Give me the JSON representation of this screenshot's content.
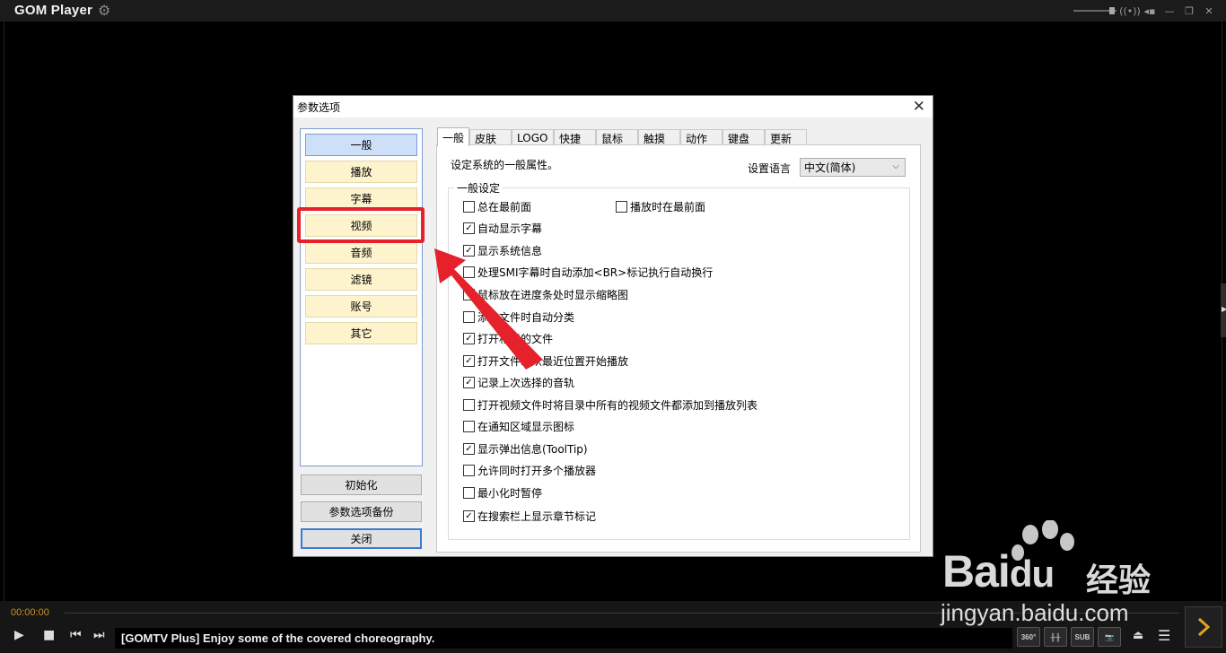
{
  "app": {
    "title": "GOM Player"
  },
  "dialog": {
    "title": "参数选项",
    "categories": [
      "一般",
      "播放",
      "字幕",
      "视频",
      "音频",
      "滤镜",
      "账号",
      "其它"
    ],
    "active_category": "一般",
    "highlighted_category": "视频",
    "buttons": {
      "reset": "初始化",
      "backup": "参数选项备份",
      "close": "关闭"
    },
    "tabs": [
      "一般",
      "皮肤",
      "LOGO",
      "快捷",
      "鼠标",
      "触摸",
      "动作",
      "键盘",
      "更新"
    ],
    "active_tab": "一般",
    "description": "设定系统的一般属性。",
    "language_label": "设置语言",
    "language_value": "中文(简体)",
    "group_title": "一般设定",
    "options": [
      {
        "label": "总在最前面",
        "checked": false
      },
      {
        "label": "播放时在最前面",
        "checked": false
      },
      {
        "label": "自动显示字幕",
        "checked": true
      },
      {
        "label": "显示系统信息",
        "checked": true
      },
      {
        "label": "处理SMI字幕时自动添加<BR>标记执行自动换行",
        "checked": false
      },
      {
        "label": "鼠标放在进度条处时显示缩略图",
        "checked": false
      },
      {
        "label": "添加文件时自动分类",
        "checked": false
      },
      {
        "label": "打开相似的文件",
        "checked": true
      },
      {
        "label": "打开文件时从最近位置开始播放",
        "checked": true
      },
      {
        "label": "记录上次选择的音轨",
        "checked": true
      },
      {
        "label": "打开视频文件时将目录中所有的视频文件都添加到播放列表",
        "checked": false
      },
      {
        "label": "在通知区域显示图标",
        "checked": false
      },
      {
        "label": "显示弹出信息(ToolTip)",
        "checked": true
      },
      {
        "label": "允许同时打开多个播放器",
        "checked": false
      },
      {
        "label": "最小化时暂停",
        "checked": false
      },
      {
        "label": "在搜索栏上显示章节标记",
        "checked": true
      }
    ]
  },
  "player": {
    "time": "00:00:00",
    "ticker": "[GOMTV Plus] Enjoy some of the covered choreography.",
    "buttons": {
      "vr": "360°",
      "sub": "SUB"
    }
  },
  "watermark": {
    "brand": "Bai",
    "brand2": "du",
    "cn": "经验",
    "url": "jingyan.baidu.com"
  },
  "colors": {
    "highlight_box": "#e5212b",
    "time_text": "#c7921f",
    "active_category_bg": "#cde0f7",
    "category_bg": "#fdf3cc"
  }
}
